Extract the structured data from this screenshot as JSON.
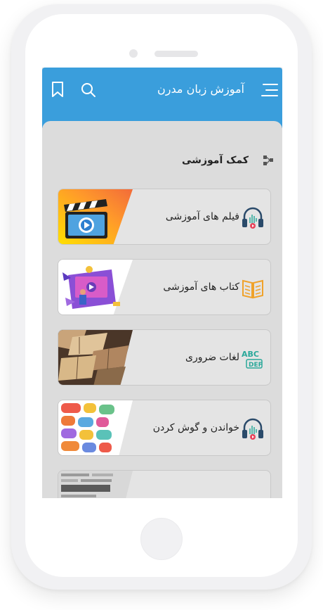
{
  "header": {
    "title": "آموزش زبان مدرن",
    "menu_icon": "hamburger-menu-icon",
    "search_icon": "search-icon",
    "bookmark_icon": "bookmark-icon"
  },
  "section": {
    "title": "کمک آموزشی",
    "icon": "share-nodes-icon"
  },
  "cards": [
    {
      "label": "فیلم های آموزشی",
      "icon": "headphones-icon",
      "thumbnail": "video-clapperboard"
    },
    {
      "label": "کتاب های آموزشی",
      "icon": "open-book-icon",
      "thumbnail": "online-learning-illustration"
    },
    {
      "label": "لغات ضروری",
      "icon": "abc-icon",
      "thumbnail": "open-books-photo"
    },
    {
      "label": "خواندن و گوش کردن",
      "icon": "headphones-icon",
      "thumbnail": "speech-bubbles-collage"
    },
    {
      "label": "",
      "icon": "",
      "thumbnail": "welcome-words-collage"
    }
  ],
  "colors": {
    "header": "#3a9edc",
    "content_background": "#dcdcdc",
    "card_background": "#e4e4e4",
    "icon_accent": "#2aa89a",
    "book_icon": "#f0a22a",
    "headphones_accent": "#e8455c"
  }
}
